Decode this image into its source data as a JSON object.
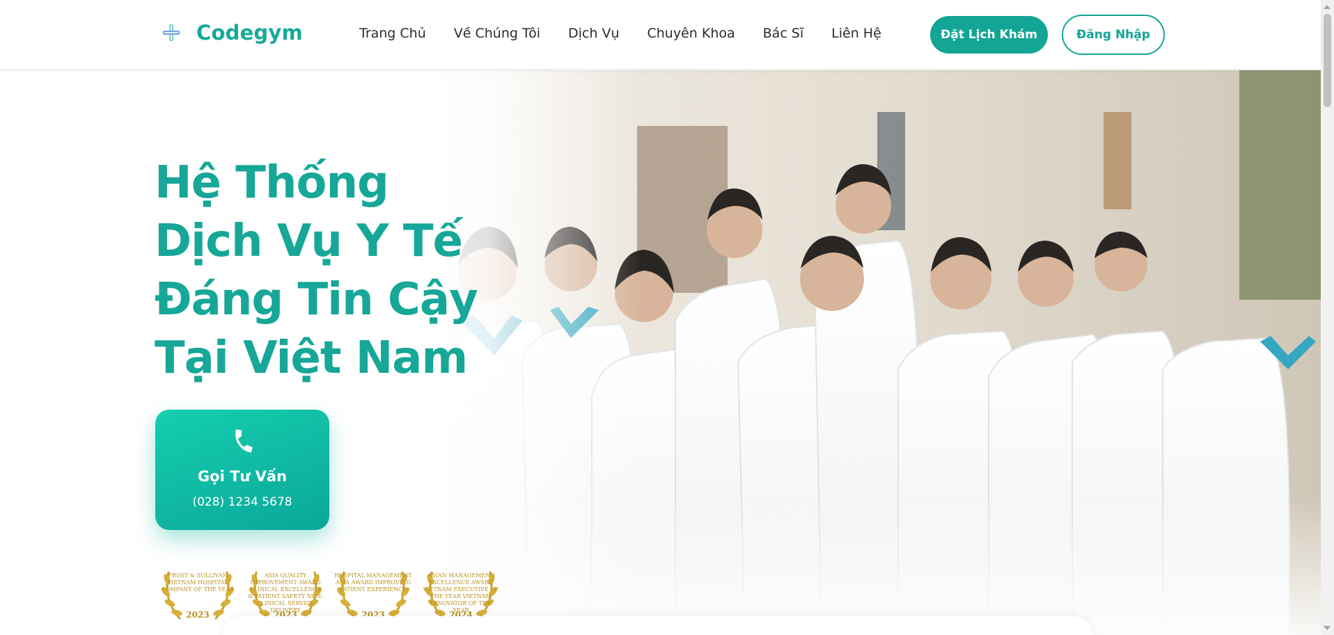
{
  "header": {
    "logo_text": "Codegym",
    "nav": [
      "Trang Chủ",
      "Về Chúng Tôi",
      "Dịch Vụ",
      "Chuyên Khoa",
      "Bác Sĩ",
      "Liên Hệ"
    ],
    "book_label": "Đặt Lịch Khám",
    "login_label": "Đăng Nhập"
  },
  "hero": {
    "title_lines": [
      "Hệ Thống",
      "Dịch Vụ Y Tế",
      "Đáng Tin Cậy",
      "Tại Việt Nam"
    ],
    "call_label": "Gọi Tư Vấn",
    "call_phone": "(028) 1234 5678"
  },
  "awards": [
    {
      "text": "FROST & SULLIVAN VIETNAM HOSPITAL COMPANY OF THE YEAR",
      "year": "2023"
    },
    {
      "text": "ASIA QUALITY IMPROVEMENT AWARD CLINICAL EXCELLENCE & PATIENT SAFETY NON-CLINICAL SERVICE DELIVERY",
      "year": "2023"
    },
    {
      "text": "HOSPITAL MANAGEMENT ASIA AWARD IMPROVING PATIENT EXPERIENCE",
      "year": "2023"
    },
    {
      "text": "ASIAN MANAGEMENT EXCELLENCE AWARD VIETNAM EXECUTIVE OF THE YEAR VIETNAM INNOVATOR OF THE YEAR",
      "year": "2024"
    }
  ],
  "colors": {
    "brand": "#13a595",
    "brand_light": "#14cfae",
    "award_gold": "#b98f1c"
  },
  "icons": [
    "plus-cross-logo-icon",
    "phone-icon",
    "laurel-wreath-icon"
  ]
}
